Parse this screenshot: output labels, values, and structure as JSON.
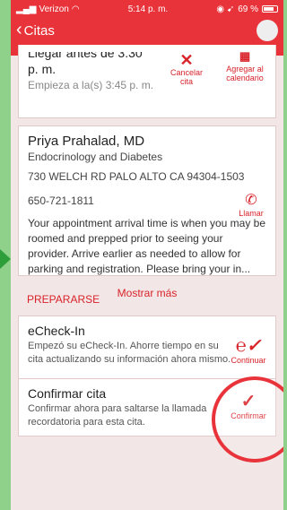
{
  "status": {
    "carrier": "Verizon",
    "time": "5:14 p. m.",
    "battery": "69 %"
  },
  "nav": {
    "back_label": "Citas"
  },
  "arrival": {
    "title_top": "Llegar antes de 3:30",
    "title": "p. m.",
    "sub": "Empieza a la(s) 3:45 p. m.",
    "cancel_label": "Cancelar cita",
    "calendar_label": "Agregar al calendario"
  },
  "provider": {
    "name": "Priya Prahalad, MD",
    "specialty": "Endocrinology and Diabetes",
    "address": "730 WELCH RD PALO ALTO CA 94304-1503",
    "phone": "650-721-1811",
    "call_label": "Llamar",
    "note": "Your appointment arrival time is when you may be roomed and prepped prior  to seeing your provider. Arrive earlier as needed to allow for parking and  registration. Please bring your in...",
    "show_more": "Mostrar más"
  },
  "prepare": {
    "heading": "PREPARARSE",
    "tasks": [
      {
        "title": "eCheck-In",
        "desc": "Empezó su eCheck-In. Ahorre tiempo en su cita actualizando su información ahora mismo.",
        "action": "Continuar"
      },
      {
        "title": "Confirmar cita",
        "desc": "Confirmar ahora para saltarse la llamada recordatoria para esta cita.",
        "action": "Confirmar"
      }
    ]
  },
  "colors": {
    "brand_red": "#e8333a",
    "frame_green": "#8fd08a"
  }
}
